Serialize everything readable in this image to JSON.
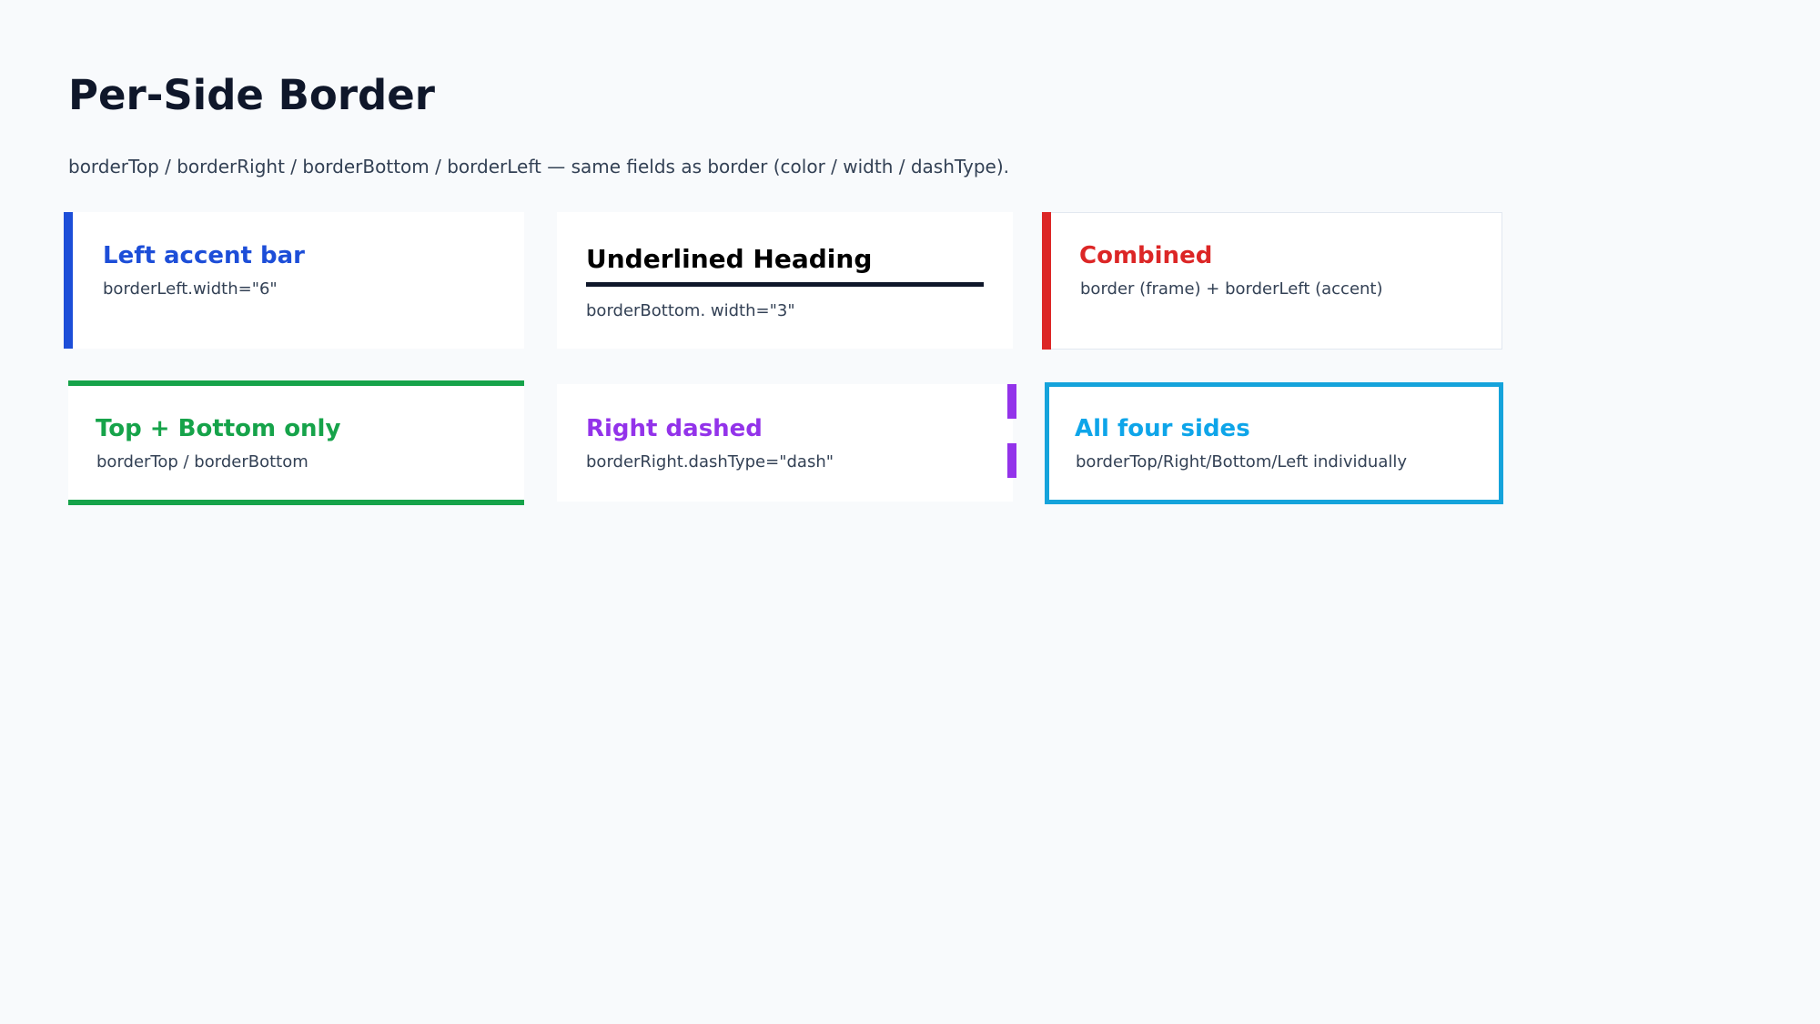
{
  "page": {
    "title": "Per-Side Border",
    "subtitle": "borderTop / borderRight / borderBottom / borderLeft — same fields as border (color / width / dashType)."
  },
  "cards": [
    {
      "title": "Left accent bar",
      "desc": "borderLeft.width=\"6\"",
      "color": "#1d4ed8"
    },
    {
      "title": "Underlined Heading",
      "desc": "borderBottom. width=\"3\"",
      "color": "#000000"
    },
    {
      "title": "Combined",
      "desc": "border (frame) + borderLeft (accent)",
      "color": "#dc2626"
    },
    {
      "title": "Top + Bottom only",
      "desc": "borderTop / borderBottom",
      "color": "#16a34a"
    },
    {
      "title": "Right dashed",
      "desc": "borderRight.dashType=\"dash\"",
      "color": "#9333ea"
    },
    {
      "title": "All four sides",
      "desc": "borderTop/Right/Bottom/Left individually",
      "color": "#0ea5e9"
    }
  ]
}
